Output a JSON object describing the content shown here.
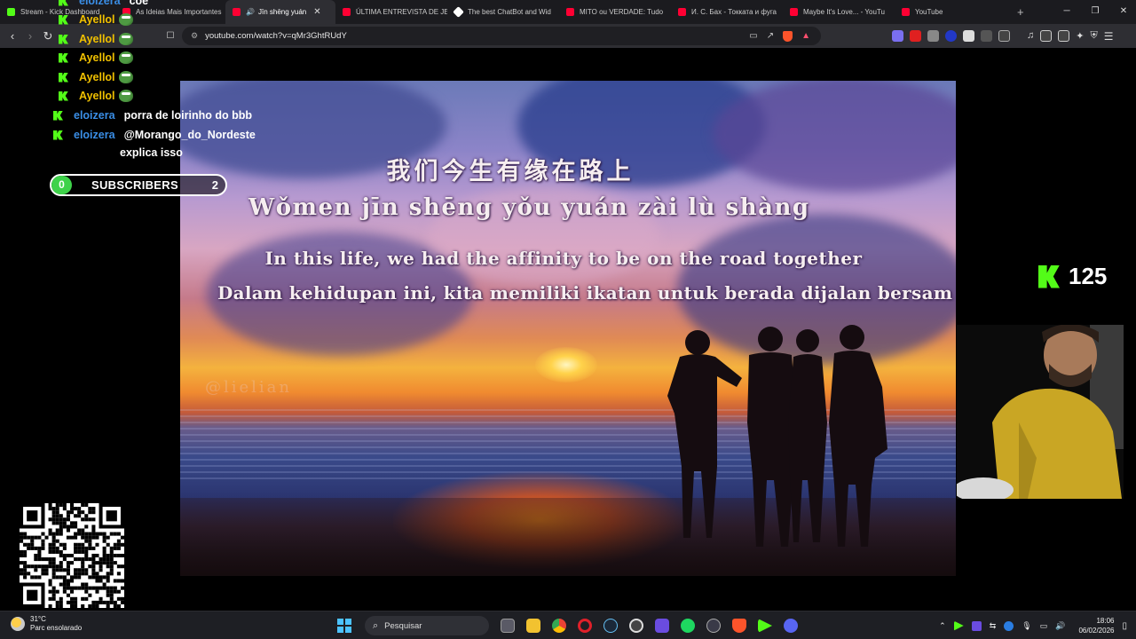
{
  "browser": {
    "tabs": [
      {
        "title": "Stream - Kick Dashboard",
        "color": "#53fc18"
      },
      {
        "title": "As Ideias Mais Importantes",
        "color": "#ff0033"
      },
      {
        "title": "Jīn shēng yuán",
        "color": "#ff0033",
        "active": true,
        "audio": "🔊",
        "close": "✕"
      },
      {
        "title": "ÚLTIMA ENTREVISTA DE JE",
        "color": "#ff0033"
      },
      {
        "title": "The best ChatBot and Wid",
        "color": "#ffffff"
      },
      {
        "title": "MITO ou VERDADE: Tudo",
        "color": "#ff0033"
      },
      {
        "title": "И. С. Бах - Токката и фуга",
        "color": "#ff0033"
      },
      {
        "title": "Maybe It's Love... - YouTu",
        "color": "#ff0033"
      },
      {
        "title": "YouTube",
        "color": "#ff0033"
      }
    ],
    "new_tab": "+",
    "window_controls": {
      "minimize": "─",
      "restore": "❐",
      "close": "✕"
    },
    "url": "youtube.com/watch?v=qMr3GhtRUdY",
    "nav": {
      "back": "‹",
      "forward": "›",
      "reload": "↻",
      "bookmark": "☐"
    }
  },
  "chat": {
    "messages": [
      {
        "user": "eloizera",
        "text": "coe",
        "color": "blue"
      },
      {
        "user": "Ayellol",
        "emote": "pepe",
        "color": "yellow"
      },
      {
        "user": "Ayellol",
        "emote": "pepe",
        "color": "yellow"
      },
      {
        "user": "Ayellol",
        "emote": "pepe",
        "color": "yellow"
      },
      {
        "user": "Ayellol",
        "emote": "pepe",
        "color": "yellow"
      },
      {
        "user": "Ayellol",
        "emote": "pepe",
        "color": "yellow"
      },
      {
        "user": "eloizera",
        "text": "porra de loirinho do bbb",
        "color": "blue"
      },
      {
        "user": "eloizera",
        "text": "@Morango_do_Nordeste",
        "text2": "explica isso",
        "color": "blue"
      }
    ]
  },
  "subscribers_bar": {
    "left_count": "0",
    "label": "SUBSCRIBERS",
    "right_count": "2"
  },
  "video": {
    "lyric_chinese": "我们今生有缘在路上",
    "lyric_pinyin": "Wǒmen jīn shēng yǒu yuán zài lù shàng",
    "lyric_english": "In this life, we had the affinity to be on the road together",
    "lyric_indonesian": "Dalam kehidupan ini, kita memiliki ikatan untuk berada dijalan bersam",
    "watermark": "@lielian"
  },
  "viewer_count": "125",
  "taskbar": {
    "weather_temp": "31°C",
    "weather_desc": "Parc ensolarado",
    "search_placeholder": "Pesquisar",
    "time": "18:06",
    "date": "06/02/2026"
  },
  "colors": {
    "kick_green": "#53fc18",
    "username_yellow": "#f0c000",
    "username_blue": "#3a8ee6",
    "subs_green": "#3ed24a"
  }
}
